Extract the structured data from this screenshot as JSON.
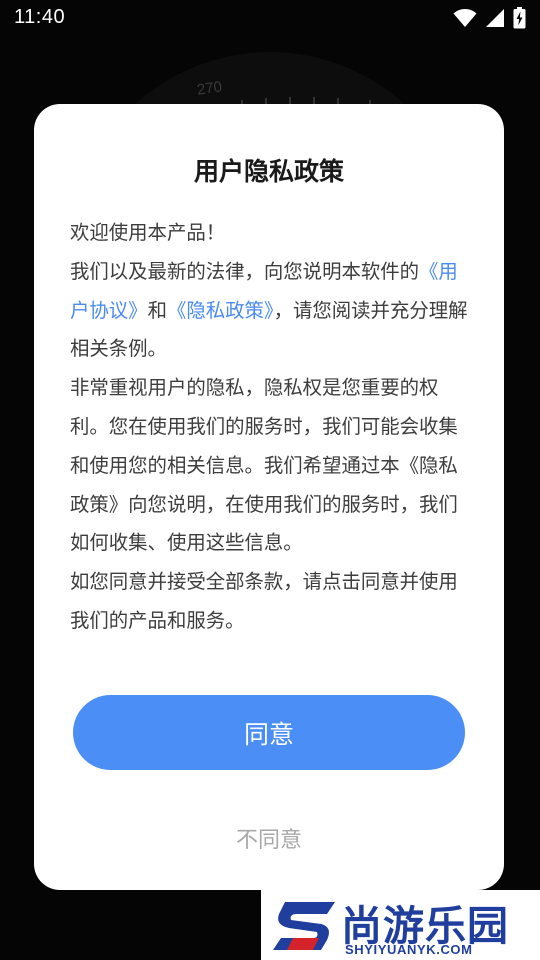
{
  "status_bar": {
    "time": "11:40",
    "icons": [
      "wifi-icon",
      "cell-signal-icon",
      "battery-charging-icon"
    ]
  },
  "background": {
    "dial_number": "270"
  },
  "dialog": {
    "title": "用户隐私政策",
    "body": {
      "welcome": "欢迎使用本产品！",
      "para1_prefix": "我们以及最新的法律，向您说明本软件的",
      "user_agreement_link": "《用户协议》",
      "para1_and": "和",
      "privacy_policy_link": "《隐私政策》",
      "para1_suffix": "，请您阅读并充分理解相关条例。",
      "para2": "非常重视用户的隐私，隐私权是您重要的权利。您在使用我们的服务时，我们可能会收集和使用您的相关信息。我们希望通过本《隐私政策》向您说明，在使用我们的服务时，我们如何收集、使用这些信息。",
      "para3": "如您同意并接受全部条款，请点击同意并使用我们的产品和服务。"
    },
    "agree_label": "同意",
    "disagree_label": "不同意"
  },
  "watermark": {
    "name_cn": "尚游乐园",
    "name_en": "SHYIYUANYK.COM"
  },
  "colors": {
    "accent": "#4b8ef6",
    "link": "#4a8af4",
    "watermark": "#1f3e9e"
  }
}
